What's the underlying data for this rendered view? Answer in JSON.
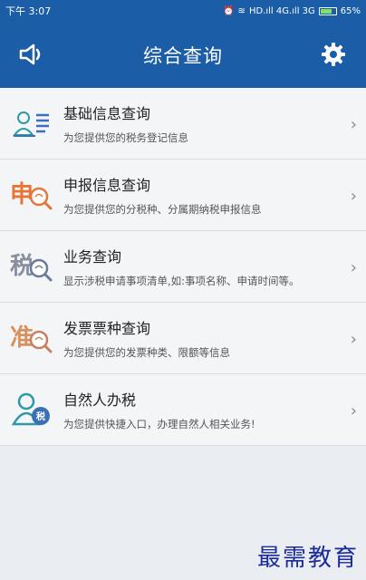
{
  "status_bar": {
    "time": "下午 3:07",
    "network": "HD.ıll 4G.ıll 3G",
    "battery": "65%"
  },
  "header": {
    "title": "综合查询",
    "left_icon": "speaker-icon",
    "right_icon": "gear-icon"
  },
  "items": [
    {
      "title": "基础信息查询",
      "subtitle": "为您提供您的税务登记信息",
      "icon": "id-card-icon"
    },
    {
      "title": "申报信息查询",
      "subtitle": "为您提供您的分税种、分属期纳税申报信息",
      "icon": "shen-search-icon"
    },
    {
      "title": "业务查询",
      "subtitle": "显示涉税申请事项清单,如:事项名称、申请时间等。",
      "icon": "shui-search-icon"
    },
    {
      "title": "发票票种查询",
      "subtitle": "为您提供您的发票种类、限额等信息",
      "icon": "zhun-search-icon"
    },
    {
      "title": "自然人办税",
      "subtitle": "为您提供快捷入口，办理自然人相关业务!",
      "icon": "person-tax-icon"
    }
  ],
  "watermark": "最需教育",
  "colors": {
    "header_bg": "#1b5ea7",
    "icon_blue": "#3b6fb6",
    "icon_teal": "#2a9aa6",
    "icon_orange": "#e6753a",
    "chevron": "#888888"
  }
}
